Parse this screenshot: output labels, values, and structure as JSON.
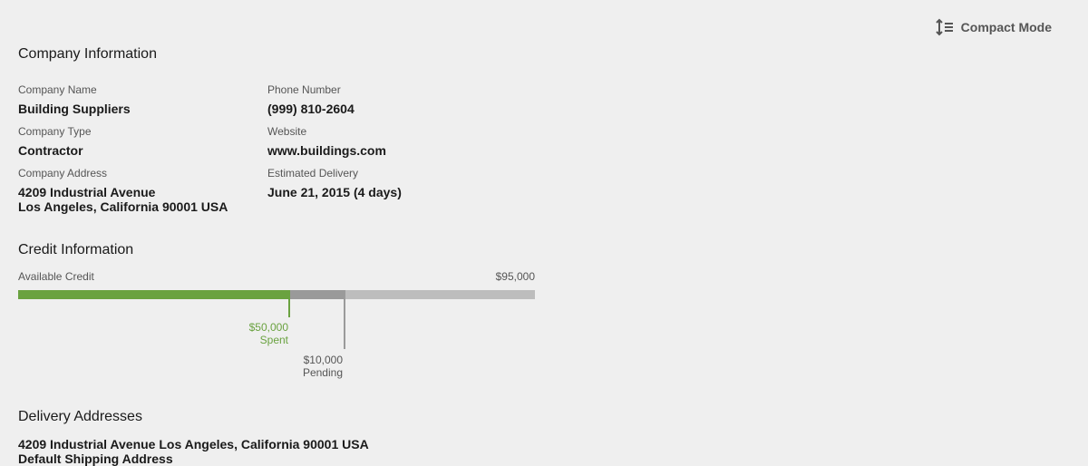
{
  "toolbar": {
    "compact_label": "Compact Mode",
    "compact_icon": "line-height-icon"
  },
  "company": {
    "heading": "Company Information",
    "name_label": "Company Name",
    "name_value": "Building Suppliers",
    "type_label": "Company Type",
    "type_value": "Contractor",
    "address_label": "Company Address",
    "address_line1": "4209 Industrial Avenue",
    "address_line2": "Los Angeles, California 90001 USA",
    "phone_label": "Phone Number",
    "phone_value": "(999) 810-2604",
    "website_label": "Website",
    "website_value": "www.buildings.com",
    "delivery_label": "Estimated Delivery",
    "delivery_value": "June 21, 2015 (4 days)"
  },
  "credit": {
    "heading": "Credit Information",
    "available_label": "Available Credit",
    "total_text": "$95,000",
    "total": 95000,
    "spent": 50000,
    "pending": 10000,
    "spent_amount": "$50,000",
    "spent_label": "Spent",
    "pending_amount": "$10,000",
    "pending_label": "Pending",
    "colors": {
      "spent": "#6aa240",
      "pending": "#9a9a9a",
      "track": "#bdbdbd"
    }
  },
  "delivery": {
    "heading": "Delivery Addresses",
    "address": "4209 Industrial Avenue Los Angeles, California 90001 USA",
    "note": "Default Shipping Address"
  }
}
